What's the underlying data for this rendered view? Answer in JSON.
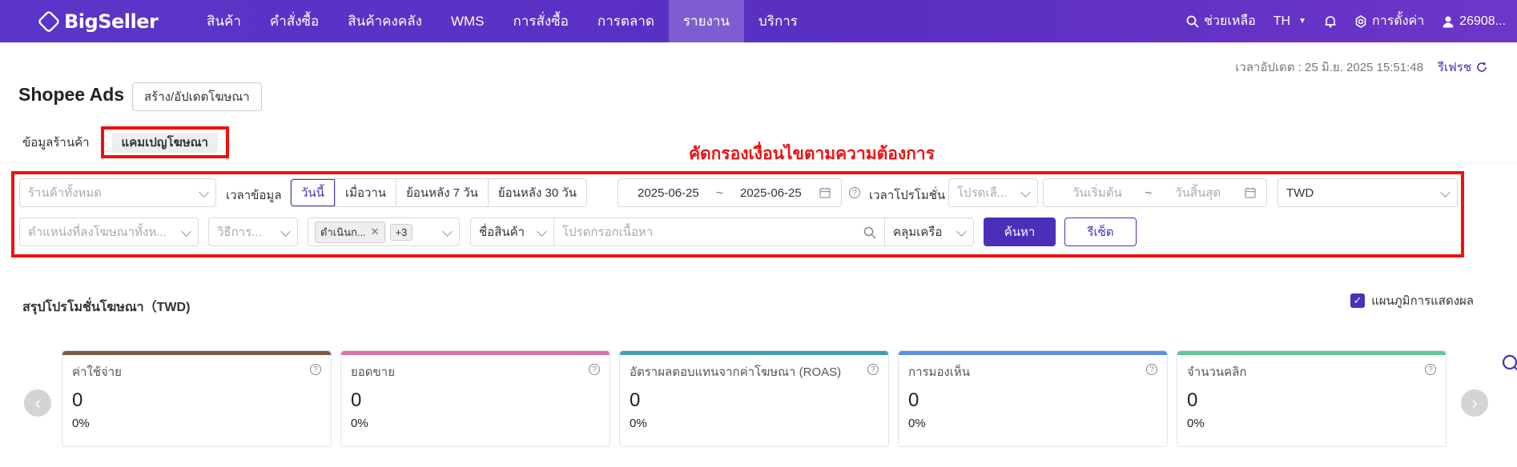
{
  "brand": "BigSeller",
  "nav": {
    "items": [
      "สินค้า",
      "คำสั่งซื้อ",
      "สินค้าคงคลัง",
      "WMS",
      "การสั่งซื้อ",
      "การตลาด",
      "รายงาน",
      "บริการ"
    ],
    "active_index": 6,
    "help": "ช่วยเหลือ",
    "lang": "TH",
    "settings": "การตั้งค่า",
    "user": "26908..."
  },
  "header": {
    "updated_text": "เวลาอัปเดต : 25 มิ.ย. 2025 15:51:48",
    "refresh": "รีเฟรช",
    "title": "Shopee Ads",
    "create_button": "สร้าง/อัปเดตโฆษณา"
  },
  "subtabs": {
    "shop_info": "ข้อมูลร้านค้า",
    "campaign": "แคมเปญโฆษณา"
  },
  "annotation": "คัดกรองเงื่อนไขตามความต้องการ",
  "filters": {
    "store_placeholder": "ร้านค้าทั้งหมด",
    "data_time_label": "เวลาข้อมูล",
    "time_options": [
      "วันนี้",
      "เมื่อวาน",
      "ย้อนหลัง 7 วัน",
      "ย้อนหลัง 30 วัน"
    ],
    "date_start": "2025-06-25",
    "date_sep": "~",
    "date_end": "2025-06-25",
    "promo_time_label": "เวลาโปรโมชั่น",
    "promo_select_placeholder": "โปรดเลื...",
    "promo_start_placeholder": "วันเริ่มต้น",
    "promo_end_placeholder": "วันสิ้นสุด",
    "currency": "TWD",
    "placement_placeholder": "ตำแหน่งที่ลงโฆษณาทั้งห...",
    "method_placeholder": "วิธีการ...",
    "status_tag": "ดำเนินก...",
    "status_more": "+3",
    "product_field": "ชื่อสินค้า",
    "search_placeholder": "โปรดกรอกเนื้อหา",
    "match_mode": "คลุมเครือ",
    "search_button": "ค้นหา",
    "reset_button": "รีเซ็ต"
  },
  "summary": {
    "title": "สรุปโปรโมชั่นโฆษณา（TWD)",
    "chart_toggle": "แผนภูมิการแสดงผล",
    "cards": [
      {
        "title": "ค่าใช้จ่าย",
        "value": "0",
        "percent": "0%",
        "color": "#7a5a45"
      },
      {
        "title": "ยอดขาย",
        "value": "0",
        "percent": "0%",
        "color": "#e06fa6"
      },
      {
        "title": "อัตราผลตอบแทนจากค่าโฆษณา (ROAS)",
        "value": "0",
        "percent": "0%",
        "color": "#3f9fb5"
      },
      {
        "title": "การมองเห็น",
        "value": "0",
        "percent": "0%",
        "color": "#5b8fe0"
      },
      {
        "title": "จำนวนคลิก",
        "value": "0",
        "percent": "0%",
        "color": "#5cc99a"
      }
    ]
  }
}
